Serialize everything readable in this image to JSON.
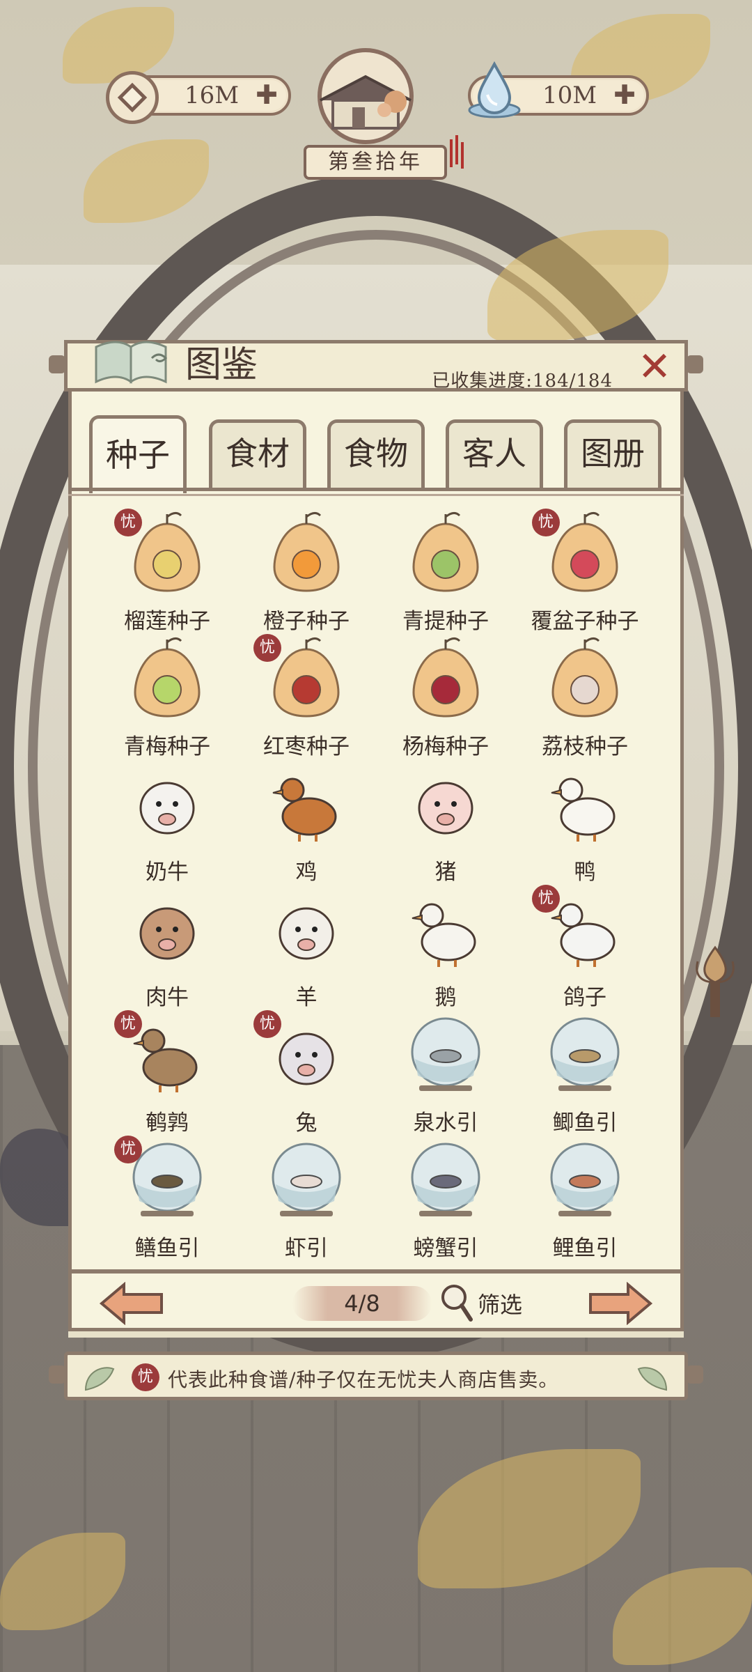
{
  "hud": {
    "coins": "16M",
    "water": "10M",
    "year": "第叁拾年"
  },
  "panel": {
    "title": "图鉴",
    "progress": "已收集进度:184/184",
    "close_icon": "close-x-icon"
  },
  "tabs": [
    {
      "label": "种子",
      "active": true
    },
    {
      "label": "食材",
      "active": false
    },
    {
      "label": "食物",
      "active": false
    },
    {
      "label": "客人",
      "active": false
    },
    {
      "label": "图册",
      "active": false
    }
  ],
  "badge_char": "忧",
  "items": [
    {
      "label": "榴莲种子",
      "icon": "durian-seed-bag",
      "badge": true
    },
    {
      "label": "橙子种子",
      "icon": "orange-seed-bag",
      "badge": false
    },
    {
      "label": "青提种子",
      "icon": "green-grape-seed-bag",
      "badge": false
    },
    {
      "label": "覆盆子种子",
      "icon": "raspberry-seed-bag",
      "badge": true
    },
    {
      "label": "青梅种子",
      "icon": "green-plum-seed-bag",
      "badge": false
    },
    {
      "label": "红枣种子",
      "icon": "red-date-seed-bag",
      "badge": true
    },
    {
      "label": "杨梅种子",
      "icon": "bayberry-seed-bag",
      "badge": false
    },
    {
      "label": "荔枝种子",
      "icon": "lychee-seed-bag",
      "badge": false
    },
    {
      "label": "奶牛",
      "icon": "dairy-cow",
      "badge": false
    },
    {
      "label": "鸡",
      "icon": "chicken",
      "badge": false
    },
    {
      "label": "猪",
      "icon": "pig",
      "badge": false
    },
    {
      "label": "鸭",
      "icon": "duck",
      "badge": false
    },
    {
      "label": "肉牛",
      "icon": "beef-cattle",
      "badge": false
    },
    {
      "label": "羊",
      "icon": "goat",
      "badge": false
    },
    {
      "label": "鹅",
      "icon": "goose",
      "badge": false
    },
    {
      "label": "鸽子",
      "icon": "pigeon",
      "badge": true
    },
    {
      "label": "鹌鹑",
      "icon": "quail",
      "badge": true
    },
    {
      "label": "兔",
      "icon": "rabbit",
      "badge": true
    },
    {
      "label": "泉水引",
      "icon": "spring-water-bowl",
      "badge": false
    },
    {
      "label": "鲫鱼引",
      "icon": "crucian-carp-bowl",
      "badge": false
    },
    {
      "label": "鳝鱼引",
      "icon": "eel-bowl",
      "badge": true
    },
    {
      "label": "虾引",
      "icon": "shrimp-bowl",
      "badge": false
    },
    {
      "label": "螃蟹引",
      "icon": "crab-bowl",
      "badge": false
    },
    {
      "label": "鲤鱼引",
      "icon": "carp-bowl",
      "badge": false
    }
  ],
  "pager": {
    "page": "4/8",
    "filter_label": "筛选"
  },
  "footnote": "代表此种食谱/种子仅在无忧夫人商店售卖。",
  "colors": {
    "frame": "#8c7a6b",
    "paper": "#f7f4df",
    "badge": "#9b3b3b",
    "close": "#a33b34",
    "seed_bag": "#f0c58a"
  }
}
